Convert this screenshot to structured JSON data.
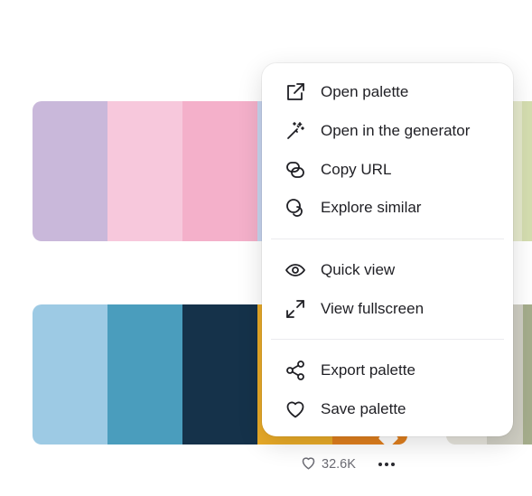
{
  "palettes": [
    {
      "colors": [
        "#c9b8da",
        "#f7c8dc",
        "#f4b0ca",
        "#c7d5ef",
        "#f2f2ea"
      ]
    },
    {
      "colors": [
        "#9dcae4",
        "#4a9dbd",
        "#15324a",
        "#e9ab28",
        "#e07f1e"
      ]
    }
  ],
  "side_cards": [
    {
      "colors": [
        "#e5e9cc",
        "#d5deb0"
      ]
    },
    {
      "colors": [
        "#e6e4dc",
        "#cfcec3",
        "#a5ad8c"
      ]
    }
  ],
  "stats": {
    "likes": "32.6K",
    "like_icon": "heart-outline-icon",
    "more_icon": "ellipsis-horizontal-icon"
  },
  "menu": {
    "groups": [
      [
        {
          "label": "Open palette",
          "icon": "external-link-icon"
        },
        {
          "label": "Open in the generator",
          "icon": "magic-wand-icon"
        },
        {
          "label": "Copy URL",
          "icon": "link-icon"
        },
        {
          "label": "Explore similar",
          "icon": "explore-similar-icon"
        }
      ],
      [
        {
          "label": "Quick view",
          "icon": "eye-icon"
        },
        {
          "label": "View fullscreen",
          "icon": "expand-icon"
        }
      ],
      [
        {
          "label": "Export palette",
          "icon": "share-icon"
        },
        {
          "label": "Save palette",
          "icon": "heart-icon"
        }
      ]
    ]
  }
}
